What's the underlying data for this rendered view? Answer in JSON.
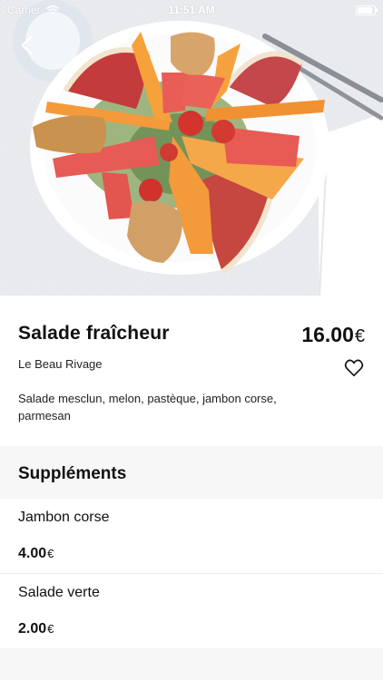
{
  "status_bar": {
    "carrier": "Carrier",
    "time": "11:51 AM"
  },
  "dish": {
    "name": "Salade fraîcheur",
    "price": "16.00",
    "currency": "€",
    "restaurant": "Le Beau Rivage",
    "description": "Salade mesclun, melon, pastèque, jambon corse, parmesan"
  },
  "supplements": {
    "title": "Suppléments",
    "items": [
      {
        "name": "Jambon corse",
        "price": "4.00",
        "currency": "€"
      },
      {
        "name": "Salade verte",
        "price": "2.00",
        "currency": "€"
      }
    ]
  },
  "icons": {
    "back": "chevron-left-icon",
    "favorite": "heart-outline-icon",
    "wifi": "wifi-icon",
    "battery": "battery-icon"
  },
  "colors": {
    "background": "#f7f7f8",
    "card": "#ffffff",
    "text": "#111111"
  }
}
